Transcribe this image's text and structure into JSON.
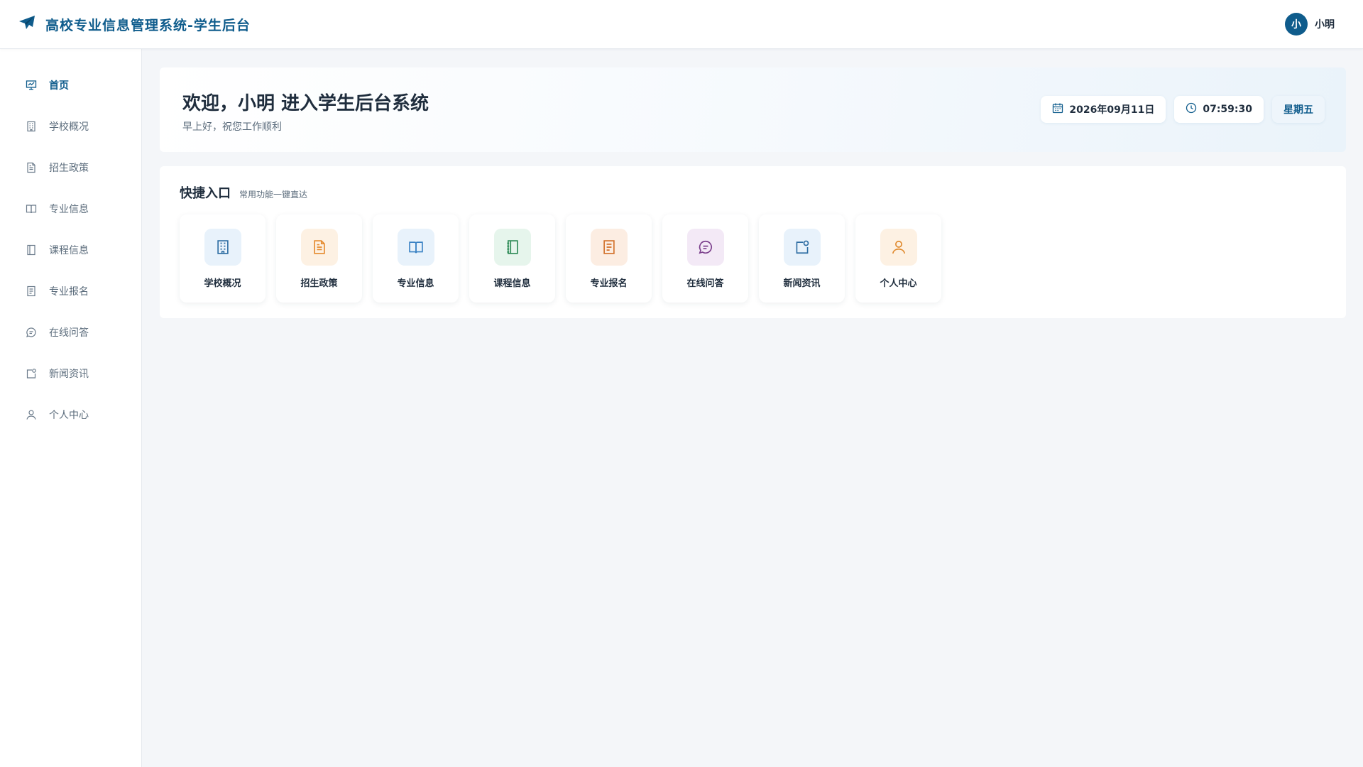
{
  "header": {
    "title": "高校专业信息管理系统-学生后台",
    "user_initial": "小",
    "user_name": "小明"
  },
  "sidebar": {
    "items": [
      {
        "label": "首页",
        "icon": "presentation-chart-icon",
        "active": true
      },
      {
        "label": "学校概况",
        "icon": "building-icon",
        "active": false
      },
      {
        "label": "招生政策",
        "icon": "document-icon",
        "active": false
      },
      {
        "label": "专业信息",
        "icon": "book-open-icon",
        "active": false
      },
      {
        "label": "课程信息",
        "icon": "notebook-icon",
        "active": false
      },
      {
        "label": "专业报名",
        "icon": "form-icon",
        "active": false
      },
      {
        "label": "在线问答",
        "icon": "chat-bubble-icon",
        "active": false
      },
      {
        "label": "新闻资讯",
        "icon": "news-icon",
        "active": false
      },
      {
        "label": "个人中心",
        "icon": "user-icon",
        "active": false
      }
    ]
  },
  "welcome": {
    "title": "欢迎，小明 进入学生后台系统",
    "subtitle": "早上好，祝您工作顺利",
    "date": "2026年09月11日",
    "time": "07:59:30",
    "weekday": "星期五"
  },
  "quick": {
    "title": "快捷入口",
    "subtitle": "常用功能一键直达",
    "cards": [
      {
        "label": "学校概况",
        "icon": "building-icon",
        "color": "#2f6ea3",
        "bg": "#e8f2fb"
      },
      {
        "label": "招生政策",
        "icon": "document-icon",
        "color": "#e58a2e",
        "bg": "#fdf1e3"
      },
      {
        "label": "专业信息",
        "icon": "book-open-icon",
        "color": "#3a82c4",
        "bg": "#e8f2fb"
      },
      {
        "label": "课程信息",
        "icon": "notebook-icon",
        "color": "#2e8b57",
        "bg": "#e6f5ec"
      },
      {
        "label": "专业报名",
        "icon": "form-icon",
        "color": "#d2702a",
        "bg": "#fcede2"
      },
      {
        "label": "在线问答",
        "icon": "chat-bubble-icon",
        "color": "#7b3f8c",
        "bg": "#f3e9f6"
      },
      {
        "label": "新闻资讯",
        "icon": "news-icon",
        "color": "#2f6ea3",
        "bg": "#e8f2fb"
      },
      {
        "label": "个人中心",
        "icon": "user-icon",
        "color": "#e08a2e",
        "bg": "#fdf1e3"
      }
    ]
  },
  "colors": {
    "accent": "#0f5c8c",
    "text": "#1f2d3d",
    "muted": "#5a6b7b",
    "background": "#f4f6f9"
  }
}
